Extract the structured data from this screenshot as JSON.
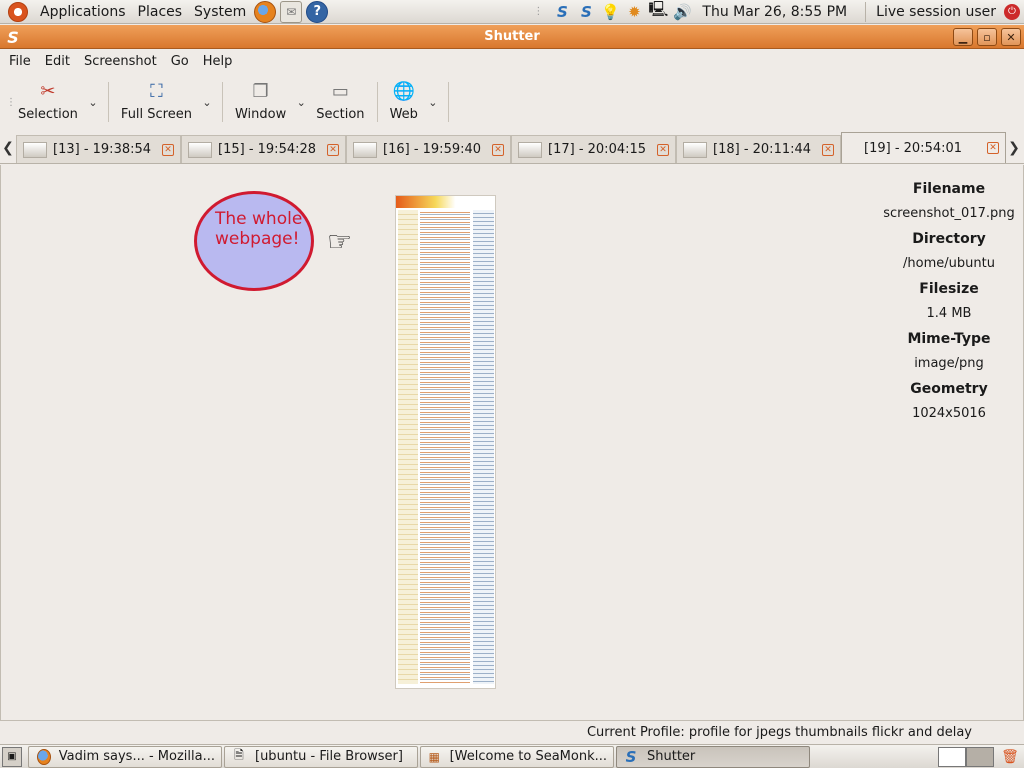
{
  "top_panel": {
    "menus": [
      "Applications",
      "Places",
      "System"
    ],
    "clock": "Thu Mar 26,  8:55 PM",
    "user": "Live session user"
  },
  "window": {
    "title": "Shutter"
  },
  "menubar": [
    "File",
    "Edit",
    "Screenshot",
    "Go",
    "Help"
  ],
  "toolbar": {
    "selection": "Selection",
    "fullscreen": "Full Screen",
    "window": "Window",
    "section": "Section",
    "web": "Web"
  },
  "tabs": [
    {
      "label": "[13] - 19:38:54"
    },
    {
      "label": "[15] - 19:54:28"
    },
    {
      "label": "[16] - 19:59:40"
    },
    {
      "label": "[17] - 20:04:15"
    },
    {
      "label": "[18] - 20:11:44"
    },
    {
      "label": "[19] - 20:54:01"
    }
  ],
  "canvas": {
    "bubble_text": "The whole webpage!"
  },
  "info": {
    "filename_label": "Filename",
    "filename": "screenshot_017.png",
    "directory_label": "Directory",
    "directory": "/home/ubuntu",
    "filesize_label": "Filesize",
    "filesize": "1.4 MB",
    "mime_label": "Mime-Type",
    "mime": "image/png",
    "geometry_label": "Geometry",
    "geometry": "1024x5016"
  },
  "status": "Current Profile: profile for jpegs thumbnails flickr and delay",
  "taskbar": [
    {
      "label": "Vadim says... - Mozilla..."
    },
    {
      "label": "[ubuntu - File Browser]"
    },
    {
      "label": "[Welcome to SeaMonk..."
    },
    {
      "label": "Shutter"
    }
  ]
}
